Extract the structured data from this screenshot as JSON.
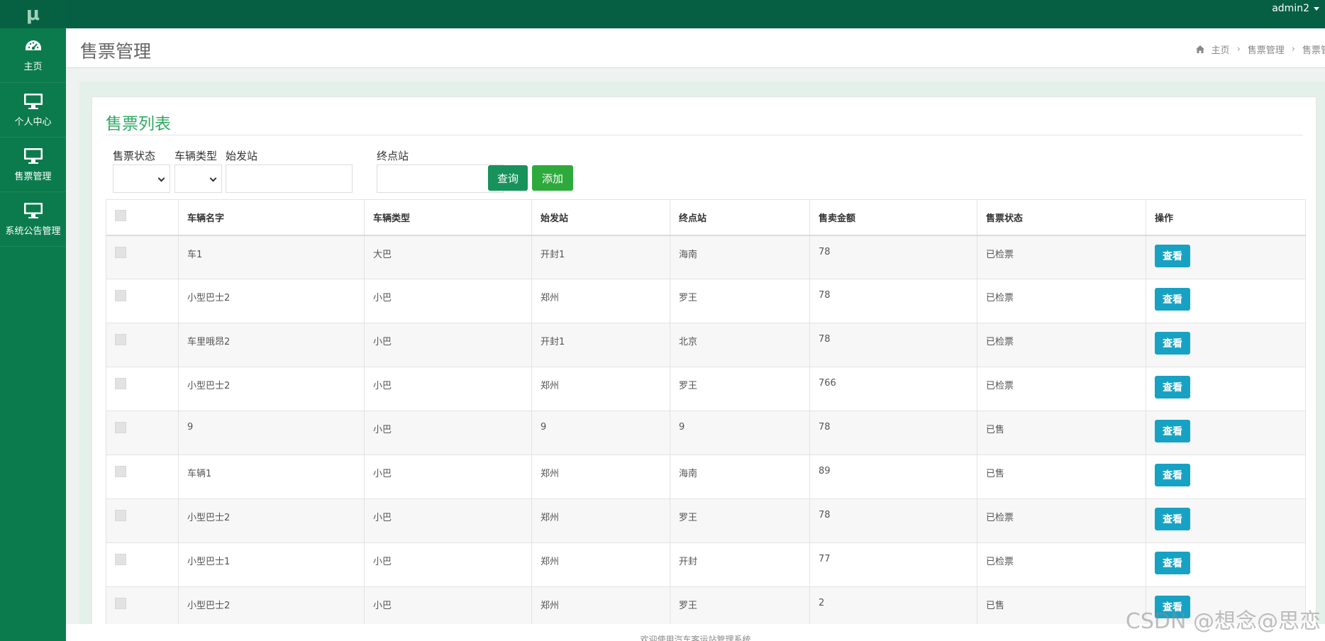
{
  "sidebar": {
    "logo": "μ",
    "items": [
      {
        "label": "主页",
        "icon": "dashboard-icon"
      },
      {
        "label": "个人中心",
        "icon": "monitor-icon"
      },
      {
        "label": "售票管理",
        "icon": "monitor-icon"
      },
      {
        "label": "系统公告管理",
        "icon": "monitor-icon"
      }
    ]
  },
  "topbar": {
    "user": "admin2"
  },
  "header": {
    "title": "售票管理",
    "breadcrumb": [
      "主页",
      "售票管理",
      "售票管理"
    ]
  },
  "panel": {
    "title": "售票列表",
    "filters": {
      "status_label": "售票状态",
      "type_label": "车辆类型",
      "start_label": "始发站",
      "end_label": "终点站",
      "query_button": "查询",
      "add_button": "添加"
    }
  },
  "table": {
    "columns": [
      "车辆名字",
      "车辆类型",
      "始发站",
      "终点站",
      "售卖金额",
      "售票状态",
      "操作"
    ],
    "view_label": "查看",
    "rows": [
      {
        "name": "车1",
        "type": "大巴",
        "start": "开封1",
        "end": "海南",
        "amount": "78",
        "status": "已检票"
      },
      {
        "name": "小型巴士2",
        "type": "小巴",
        "start": "郑州",
        "end": "罗王",
        "amount": "78",
        "status": "已检票"
      },
      {
        "name": "车里哦昂2",
        "type": "小巴",
        "start": "开封1",
        "end": "北京",
        "amount": "78",
        "status": "已检票"
      },
      {
        "name": "小型巴士2",
        "type": "小巴",
        "start": "郑州",
        "end": "罗王",
        "amount": "766",
        "status": "已检票"
      },
      {
        "name": "9",
        "type": "小巴",
        "start": "9",
        "end": "9",
        "amount": "78",
        "status": "已售"
      },
      {
        "name": "车辆1",
        "type": "小巴",
        "start": "郑州",
        "end": "海南",
        "amount": "89",
        "status": "已售"
      },
      {
        "name": "小型巴士2",
        "type": "小巴",
        "start": "郑州",
        "end": "罗王",
        "amount": "78",
        "status": "已检票"
      },
      {
        "name": "小型巴士1",
        "type": "小巴",
        "start": "郑州",
        "end": "开封",
        "amount": "77",
        "status": "已检票"
      },
      {
        "name": "小型巴士2",
        "type": "小巴",
        "start": "郑州",
        "end": "罗王",
        "amount": "2",
        "status": "已售"
      }
    ]
  },
  "footer": {
    "text": "欢迎使用汽车客运站管理系统"
  },
  "watermark": "CSDN @想念@思恋"
}
